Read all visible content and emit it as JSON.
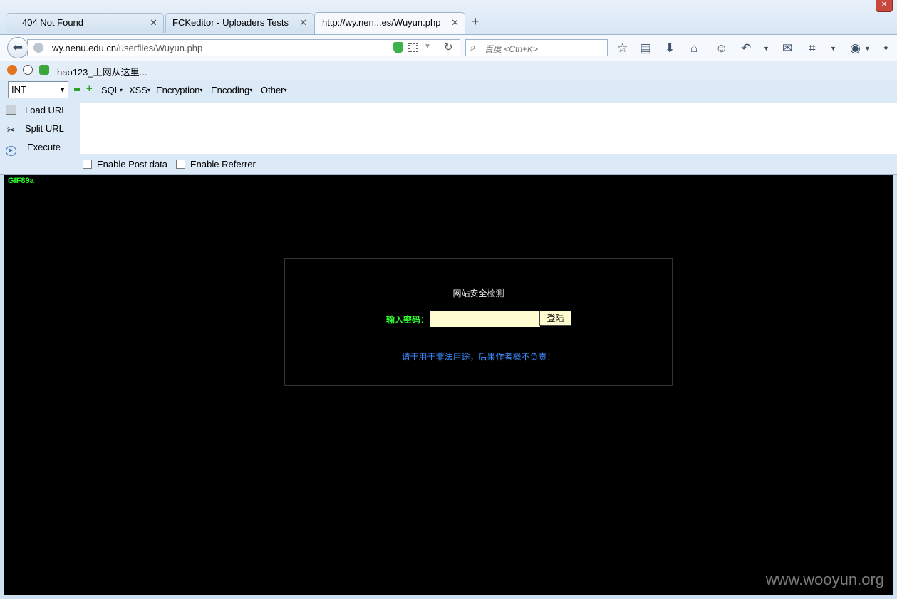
{
  "tabs": [
    {
      "label": "404 Not Found",
      "active": false
    },
    {
      "label": "FCKeditor - Uploaders Tests",
      "active": false
    },
    {
      "label": "http://wy.nen...es/Wuyun.php",
      "active": true
    }
  ],
  "address_bar": {
    "url_domain": "wy.nenu.edu.cn",
    "url_path": "/userfiles/Wuyun.php"
  },
  "search_bar": {
    "placeholder": "百度 <Ctrl+K>"
  },
  "bookmarks": [
    {
      "label": "hao123_上网从这里..."
    }
  ],
  "hackbar": {
    "type_select": "INT",
    "menus": [
      "SQL",
      "XSS",
      "Encryption",
      "Encoding",
      "Other"
    ],
    "actions": [
      "Load URL",
      "Split URL",
      "Execute"
    ],
    "checkboxes": [
      "Enable Post data",
      "Enable Referrer"
    ],
    "textarea_value": ""
  },
  "page": {
    "gif_header": "GIF89a",
    "title": "网站安全检测",
    "password_label": "输入密码：",
    "password_value": "",
    "login_button": "登陆",
    "warning": "请于用于非法用途，后果作者概不负责！"
  },
  "watermark": "www.wooyun.org",
  "colors": {
    "page_bg": "#000000",
    "gif_text": "#2cff2c",
    "label_green": "#2eff2e",
    "warning_blue": "#3d8cff",
    "input_bg": "#fffccf"
  }
}
